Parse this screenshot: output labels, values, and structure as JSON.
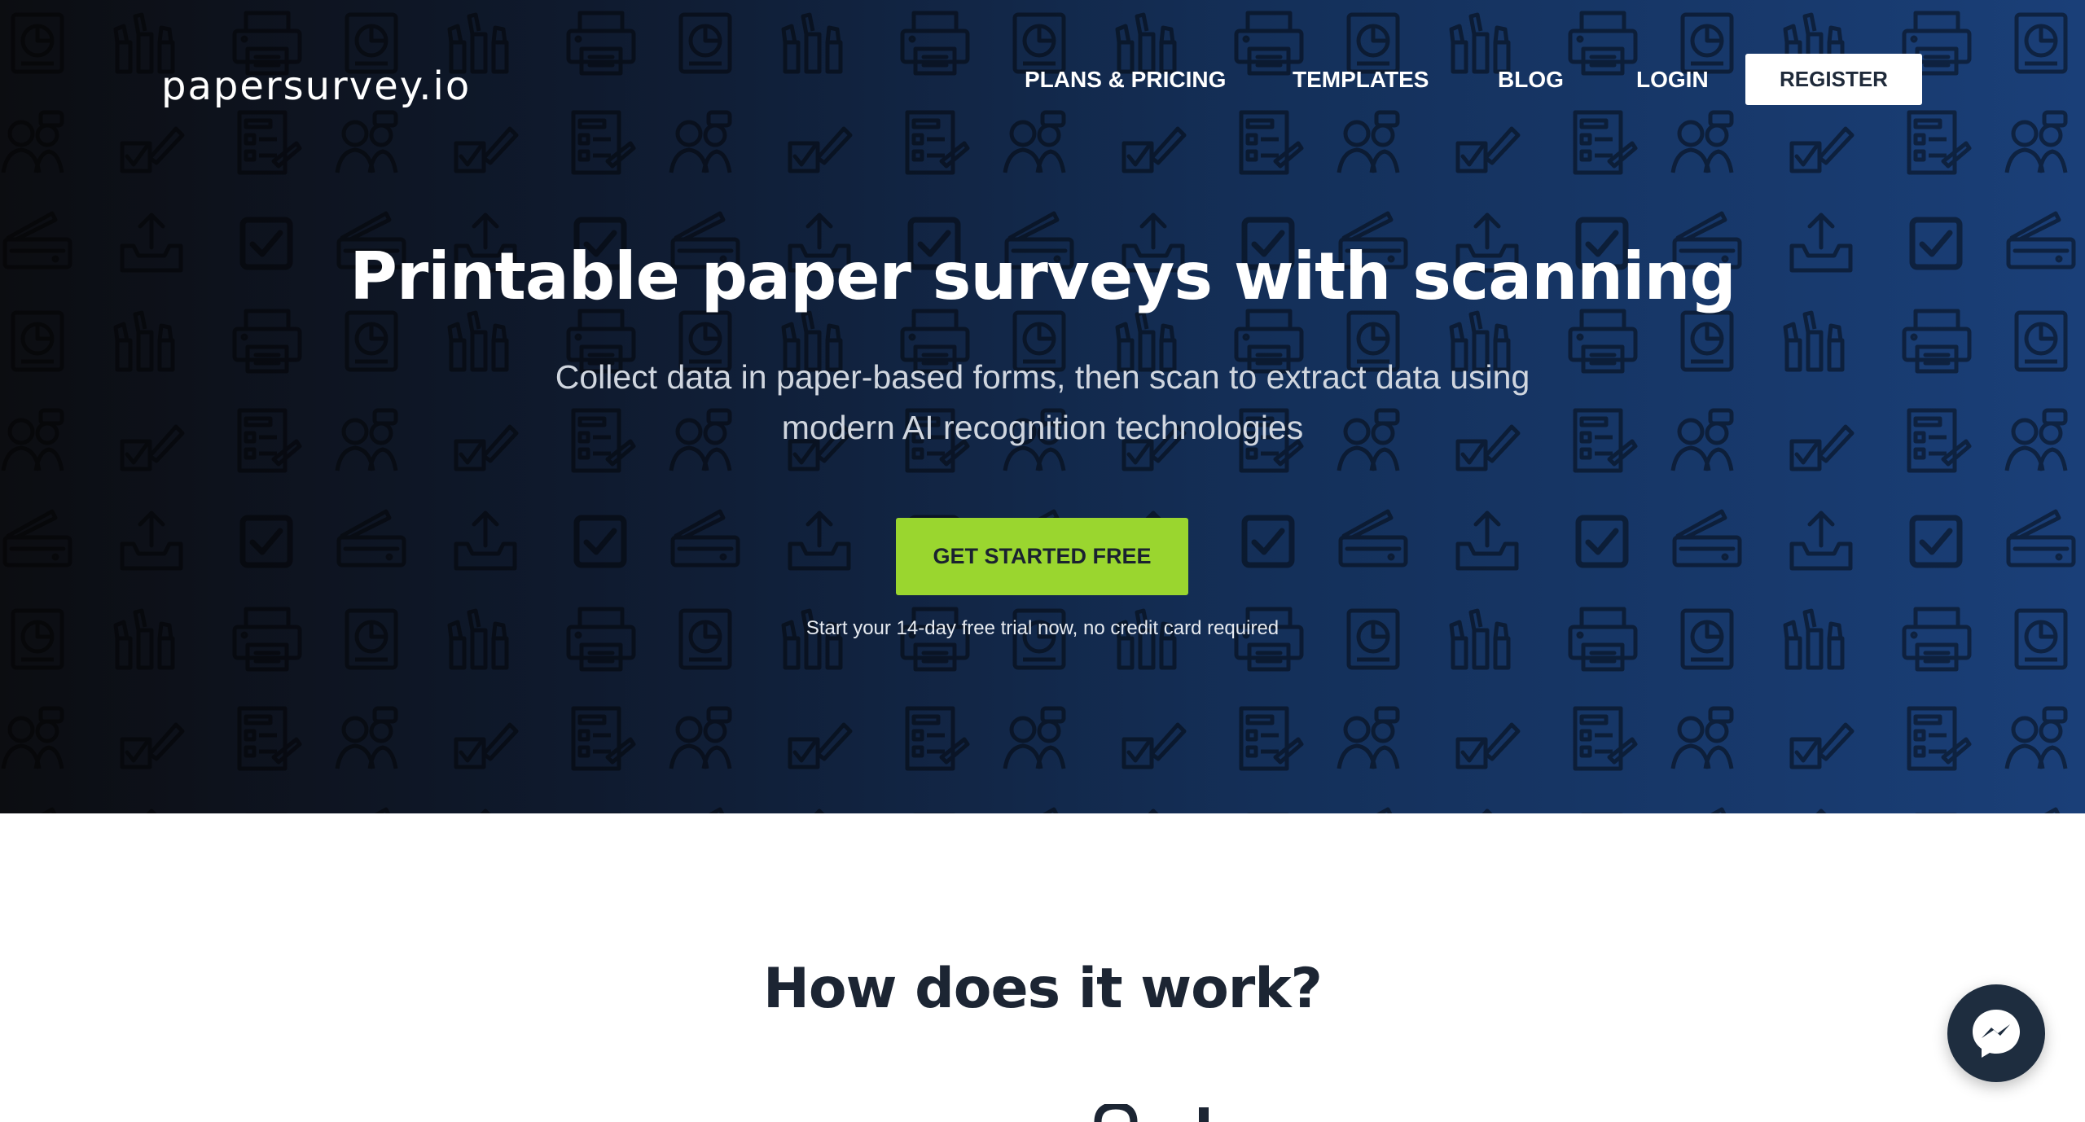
{
  "brand": {
    "logo_text": "papersurvey.io"
  },
  "nav": {
    "items": [
      "PLANS & PRICING",
      "TEMPLATES",
      "BLOG",
      "LOGIN"
    ],
    "register_label": "REGISTER"
  },
  "hero": {
    "title": "Printable paper surveys with scanning",
    "subtitle": "Collect data in paper-based forms, then scan to extract data using modern AI recognition technologies",
    "cta_label": "GET STARTED FREE",
    "trial_note": "Start your 14-day free trial now, no credit card required",
    "background_pattern_icons": [
      "printer-icon",
      "report-chart-icon",
      "hand-raise-icon",
      "survey-form-icon",
      "person-icon",
      "checkbox-pencil-icon",
      "scanner-icon",
      "upload-tray-icon",
      "checkbox-icon"
    ]
  },
  "how_it_works": {
    "title": "How does it work?"
  },
  "chat_widget": {
    "icon": "messenger-icon"
  },
  "colors": {
    "hero_dark": "#0c0d11",
    "hero_blue": "#1a3f78",
    "cta_green": "#9ad62f",
    "heading_dark": "#1c2533",
    "chat_bubble": "#1e2d3f"
  }
}
